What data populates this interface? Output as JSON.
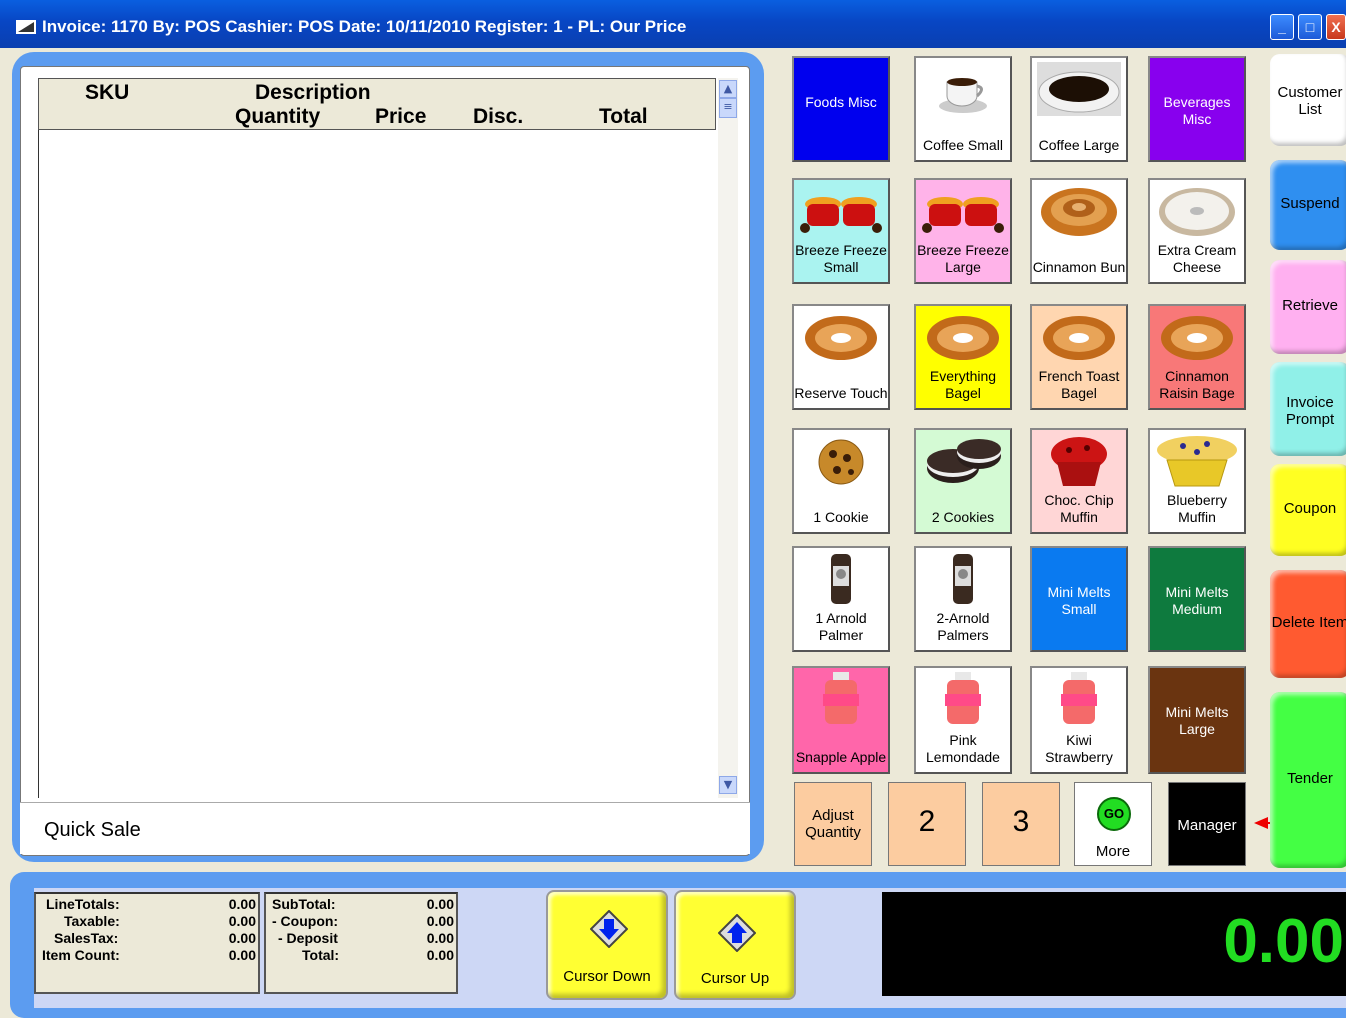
{
  "title_bar": {
    "text": "Invoice: 1170  By: POS  Cashier: POS  Date: 10/11/2010  Register: 1 - PL: Our Price",
    "buttons": [
      "_",
      "□",
      "X"
    ]
  },
  "grid": {
    "headers": {
      "sku": "SKU",
      "description": "Description",
      "quantity": "Quantity",
      "price": "Price",
      "disc": "Disc.",
      "total": "Total"
    },
    "rows": []
  },
  "quick_sale": {
    "label": "Quick Sale"
  },
  "products": [
    {
      "label": "Foods Misc",
      "color": "#0000ee",
      "icon": "none"
    },
    {
      "label": "Coffee Small",
      "color": "#ffffff",
      "icon": "coffee-cup-icon"
    },
    {
      "label": "Coffee Large",
      "color": "#ffffff",
      "icon": "coffee-cup-large-icon"
    },
    {
      "label": "Beverages Misc",
      "color": "#8800ee",
      "icon": "none"
    },
    {
      "label": "Breeze Freeze Small",
      "color": "#aaf3f0",
      "icon": "breeze-freeze-icon"
    },
    {
      "label": "Breeze Freeze Large",
      "color": "#ffb3e9",
      "icon": "breeze-freeze-icon"
    },
    {
      "label": "Cinnamon Bun",
      "color": "#ffffff",
      "icon": "cinnamon-bun-icon"
    },
    {
      "label": "Extra Cream Cheese",
      "color": "#ffffff",
      "icon": "cream-cheese-bagel-icon"
    },
    {
      "label": "Reserve Touch",
      "color": "#ffffff",
      "icon": "bagel-icon"
    },
    {
      "label": "Everything Bagel",
      "color": "#ffff00",
      "icon": "bagel-icon"
    },
    {
      "label": "French Toast Bagel",
      "color": "#ffd6b0",
      "icon": "bagel-icon"
    },
    {
      "label": "Cinnamon Raisin Bage",
      "color": "#f87878",
      "icon": "bagel-icon"
    },
    {
      "label": "1 Cookie",
      "color": "#ffffff",
      "icon": "cookie-icon"
    },
    {
      "label": "2 Cookies",
      "color": "#d4fad4",
      "icon": "sandwich-cookies-icon"
    },
    {
      "label": "Choc. Chip Muffin",
      "color": "#ffd6d6",
      "icon": "muffin-icon"
    },
    {
      "label": "Blueberry Muffin",
      "color": "#ffffff",
      "icon": "blueberry-muffin-icon"
    },
    {
      "label": "1 Arnold Palmer",
      "color": "#ffffff",
      "icon": "drink-can-icon"
    },
    {
      "label": "2-Arnold Palmers",
      "color": "#ffffff",
      "icon": "drink-can-icon"
    },
    {
      "label": "Mini Melts Small",
      "color": "#0a7af0",
      "icon": "none"
    },
    {
      "label": "Mini Melts Medium",
      "color": "#0e7a3e",
      "icon": "none"
    },
    {
      "label": "Snapple Apple",
      "color": "#ff66aa",
      "icon": "snapple-bottle-icon"
    },
    {
      "label": "Pink Lemondade",
      "color": "#ffffff",
      "icon": "snapple-bottle-icon"
    },
    {
      "label": "Kiwi Strawberry",
      "color": "#ffffff",
      "icon": "snapple-bottle-icon"
    },
    {
      "label": "Mini Melts Large",
      "color": "#6a3410",
      "icon": "none"
    }
  ],
  "bottom_row": {
    "adjust_quantity": "Adjust Quantity",
    "page2": "2",
    "page3": "3",
    "go_icon": "GO",
    "more": "More",
    "manager": "Manager"
  },
  "functions": [
    {
      "label": "Customer List",
      "color": "#ffffff"
    },
    {
      "label": "Suspend",
      "color": "#2f8ff0"
    },
    {
      "label": "Retrieve",
      "color": "#ffb0f0"
    },
    {
      "label": "Invoice Prompt",
      "color": "#90f0e8"
    },
    {
      "label": "Coupon",
      "color": "#ffff22"
    },
    {
      "label": "Delete Item",
      "color": "#ff5a30"
    },
    {
      "label": "Tender",
      "color": "#44ff44"
    }
  ],
  "totals_left": [
    {
      "label": "LineTotals:",
      "value": "0.00"
    },
    {
      "label": "Taxable:",
      "value": "0.00"
    },
    {
      "label": "SalesTax:",
      "value": "0.00"
    },
    {
      "label": "Item Count:",
      "value": "0.00"
    }
  ],
  "totals_right": [
    {
      "label": "SubTotal:",
      "value": "0.00"
    },
    {
      "label": "- Coupon:",
      "value": "0.00"
    },
    {
      "label": "- Deposit",
      "value": "0.00"
    },
    {
      "label": "Total:",
      "value": "0.00"
    }
  ],
  "cursor_down": "Cursor Down",
  "cursor_up": "Cursor Up",
  "display_total": "0.00"
}
